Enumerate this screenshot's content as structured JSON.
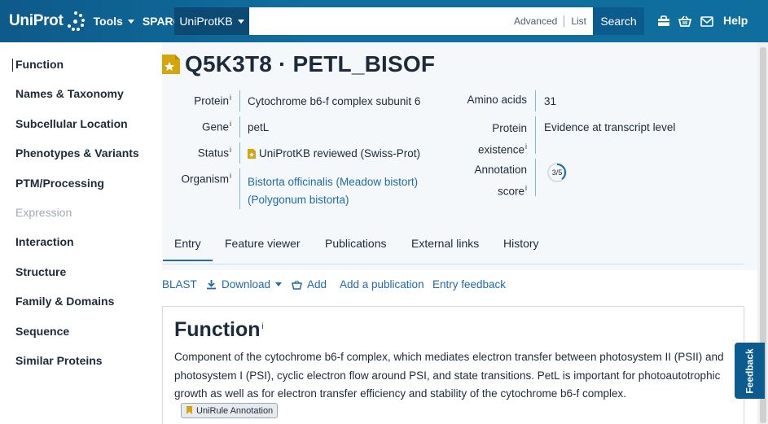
{
  "header": {
    "logo": "UniProt",
    "tools": "Tools",
    "sparql": "SPARQL",
    "database": "UniProtKB",
    "search_placeholder": "",
    "advanced": "Advanced",
    "list": "List",
    "search_button": "Search",
    "help": "Help"
  },
  "sidebar": {
    "items": [
      {
        "label": "Function"
      },
      {
        "label": "Names & Taxonomy"
      },
      {
        "label": "Subcellular Location"
      },
      {
        "label": "Phenotypes & Variants"
      },
      {
        "label": "PTM/Processing"
      },
      {
        "label": "Expression"
      },
      {
        "label": "Interaction"
      },
      {
        "label": "Structure"
      },
      {
        "label": "Family & Domains"
      },
      {
        "label": "Sequence"
      },
      {
        "label": "Similar Proteins"
      }
    ]
  },
  "entry": {
    "title": "Q5K3T8 · PETL_BISOF",
    "protein_label": "Protein",
    "protein_value": "Cytochrome b6-f complex subunit 6",
    "gene_label": "Gene",
    "gene_value": "petL",
    "status_label": "Status",
    "status_value": "UniProtKB reviewed (Swiss-Prot)",
    "organism_label": "Organism",
    "organism_line1": "Bistorta officinalis (Meadow bistort)",
    "organism_line2": "(Polygonum bistorta)",
    "amino_acids_label": "Amino acids",
    "amino_acids_value": "31",
    "existence_label_1": "Protein",
    "existence_label_2": "existence",
    "existence_value": "Evidence at transcript level",
    "annotation_label_1": "Annotation",
    "annotation_label_2": "score",
    "annotation_score": "3/5",
    "info_marker": "i"
  },
  "tabs": [
    {
      "label": "Entry"
    },
    {
      "label": "Feature viewer"
    },
    {
      "label": "Publications"
    },
    {
      "label": "External links"
    },
    {
      "label": "History"
    }
  ],
  "actions": {
    "blast": "BLAST",
    "download": "Download",
    "add": "Add",
    "add_publication": "Add a publication",
    "entry_feedback": "Entry feedback"
  },
  "function": {
    "heading": "Function",
    "text": "Component of the cytochrome b6-f complex, which mediates electron transfer between photosystem II (PSII) and photosystem I (PSI), cyclic electron flow around PSI, and state transitions. PetL is important for photoautotrophic growth as well as for electron transfer efficiency and stability of the cytochrome b6-f complex.",
    "badge": "UniRule Annotation"
  },
  "feedback": "Feedback",
  "colors": {
    "header": "#0f6e9e",
    "accent": "#1f6aa8",
    "reviewed": "#d5a50c"
  }
}
